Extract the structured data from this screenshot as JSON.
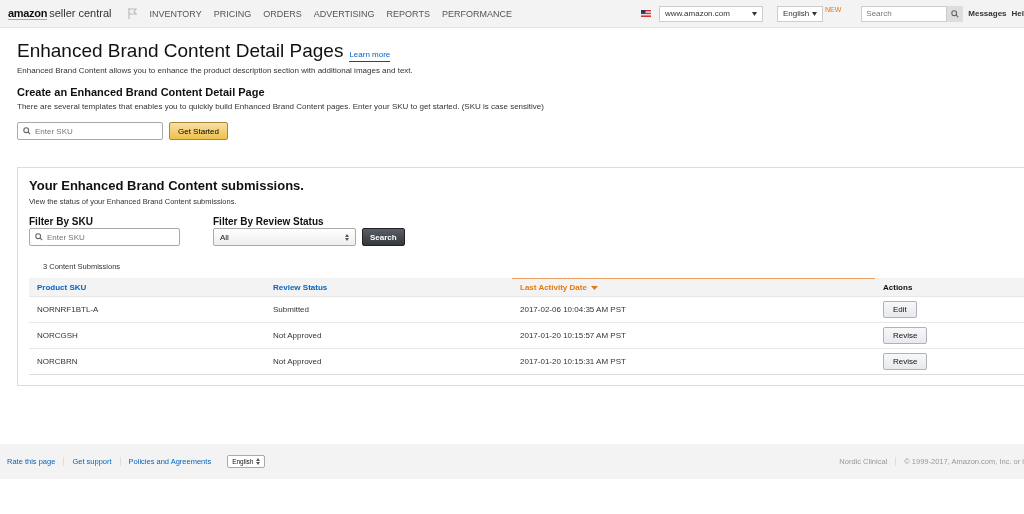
{
  "topbar": {
    "logo": "amazon",
    "logo_suffix": "seller central",
    "nav": [
      "INVENTORY",
      "PRICING",
      "ORDERS",
      "ADVERTISING",
      "REPORTS",
      "PERFORMANCE"
    ],
    "marketplace": "www.amazon.com",
    "language": "English",
    "new_badge": "NEW",
    "search_placeholder": "Search",
    "links": [
      "Messages",
      "Hel"
    ]
  },
  "header": {
    "title": "Enhanced Brand Content Detail Pages",
    "learn_more": "Learn more",
    "description": "Enhanced Brand Content allows you to enhance the product description section with additional images and text."
  },
  "create": {
    "title": "Create an Enhanced Brand Content Detail Page",
    "description": "There are several templates that enables you to quickly build Enhanced Brand Content pages. Enter your SKU to get started. (SKU is case sensitive)",
    "sku_placeholder": "Enter SKU",
    "button": "Get Started"
  },
  "submissions": {
    "title": "Your Enhanced Brand Content submissions.",
    "description": "View the status of your Enhanced Brand Content submissions.",
    "filter_sku_label": "Filter By SKU",
    "filter_sku_placeholder": "Enter SKU",
    "filter_status_label": "Filter By Review Status",
    "filter_status_value": "All",
    "search_button": "Search",
    "count": "3 Content Submissions",
    "columns": [
      {
        "label": "Product SKU",
        "sortable": true,
        "sorted": false
      },
      {
        "label": "Review Status",
        "sortable": true,
        "sorted": false
      },
      {
        "label": "Last Activity Date",
        "sortable": true,
        "sorted": true
      },
      {
        "label": "Actions",
        "sortable": false,
        "sorted": false
      }
    ],
    "rows": [
      {
        "sku": "NORNRF1BTL-A",
        "status": "Submitted",
        "date": "2017-02-06 10:04:35 AM PST",
        "action": "Edit"
      },
      {
        "sku": "NORCGSH",
        "status": "Not Approved",
        "date": "2017-01-20 10:15:57 AM PST",
        "action": "Revise"
      },
      {
        "sku": "NORCBRN",
        "status": "Not Approved",
        "date": "2017-01-20 10:15:31 AM PST",
        "action": "Revise"
      }
    ]
  },
  "footer": {
    "links": [
      "Rate this page",
      "Get support",
      "Policies and Agreements"
    ],
    "language": "English",
    "seller": "Nordic Clinical",
    "copyright": "© 1999-2017, Amazon.com, Inc. or i"
  }
}
